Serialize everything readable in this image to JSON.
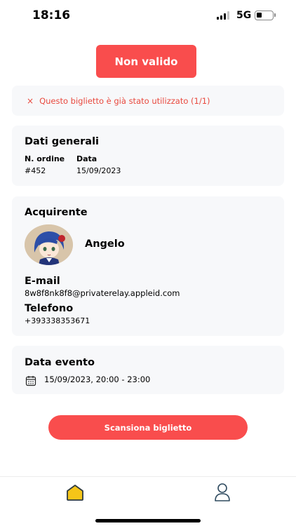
{
  "status_bar": {
    "time": "18:16",
    "network": "5G",
    "battery_level": 0.3
  },
  "badge": {
    "label": "Non valido"
  },
  "alert": {
    "icon": "x-icon",
    "glyph": "×",
    "text": "Questo biglietto è già stato utilizzato (1/1)"
  },
  "general": {
    "title": "Dati generali",
    "order_label": "N. ordine",
    "order_value": "#452",
    "date_label": "Data",
    "date_value": "15/09/2023"
  },
  "buyer": {
    "title": "Acquirente",
    "name": "Angelo",
    "email_label": "E-mail",
    "email_value": "8w8f8nk8f8@privaterelay.appleid.com",
    "phone_label": "Telefono",
    "phone_value": "+393338353671"
  },
  "event": {
    "title": "Data evento",
    "icon": "calendar-icon",
    "datetime": "15/09/2023, 20:00 - 23:00"
  },
  "actions": {
    "scan_label": "Scansiona biglietto"
  },
  "tabs": [
    {
      "name": "home",
      "icon": "home-icon",
      "active": true
    },
    {
      "name": "profile",
      "icon": "user-icon",
      "active": false
    }
  ],
  "colors": {
    "accent": "#f94d4d",
    "alert_text": "#e9493e",
    "card_bg": "#f7f8fa",
    "tab_active": "#f5c518",
    "tab_inactive": "#2e4a5f"
  }
}
